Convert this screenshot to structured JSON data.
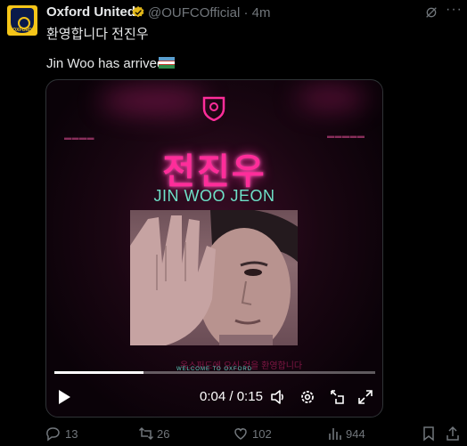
{
  "tweet": {
    "author_name": "Oxford United",
    "handle": "@OUFCOfficial",
    "separator": "·",
    "time_ago": "4m",
    "text_line1": "환영합니다 전진우",
    "text_line2": "Jin Woo has arrived."
  },
  "avatar": {
    "label": "OXFORD"
  },
  "media": {
    "hangul_name": "전진우",
    "english_name": "JIN WOO JEON",
    "welcome_text": "WELCOME TO OXFORD",
    "korean_caption": "옥스퍼드에 오신 것을 환영합니다",
    "progress_fraction": 0.278
  },
  "player": {
    "current_time": "0:04",
    "time_sep": "/",
    "duration": "0:15"
  },
  "actions": {
    "replies": "13",
    "reposts": "26",
    "likes": "102",
    "views": "944"
  },
  "icons": {
    "verified": "verified-badge-icon",
    "grok": "grok-icon",
    "more": "more-icon",
    "play": "play-icon",
    "volume": "volume-icon",
    "settings": "settings-icon",
    "pip": "picture-in-picture-icon",
    "fullscreen": "fullscreen-icon",
    "reply": "reply-icon",
    "repost": "repost-icon",
    "like": "like-icon",
    "views": "views-icon",
    "share": "share-icon"
  },
  "colors": {
    "background": "#000000",
    "text": "#e7e9ea",
    "muted": "#71767b",
    "verified": "#e2b719",
    "accent_pink": "#ff2d9a",
    "accent_teal": "#6ee0c8",
    "brand_yellow": "#f5c518"
  }
}
